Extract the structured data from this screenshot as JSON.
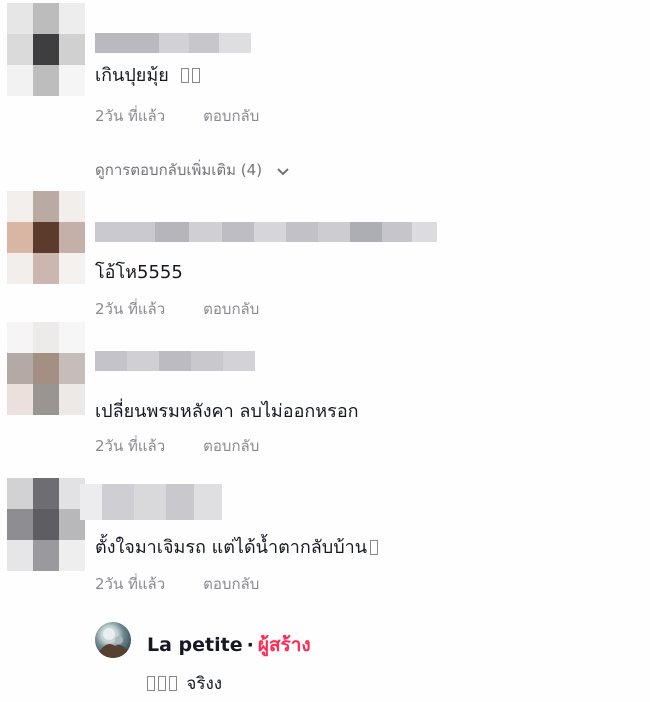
{
  "comments": [
    {
      "text": "เกินปุยมุ้ย",
      "emoji_placeholder_count": 2,
      "time": "2วัน ที่แล้ว",
      "reply_label": "ตอบกลับ"
    },
    {
      "text": "โอ้โห5555",
      "time": "2วัน ที่แล้ว",
      "reply_label": "ตอบกลับ"
    },
    {
      "text": "เปลี่ยนพรมหลังคา ลบไม่ออกหรอก",
      "time": "2วัน ที่แล้ว",
      "reply_label": "ตอบกลับ"
    },
    {
      "text": "ตั้งใจมาเจิมรถ แต่ได้น้ำตากลับบ้าน",
      "emoji_placeholder_count": 1,
      "time": "2วัน ที่แล้ว",
      "reply_label": "ตอบกลับ"
    }
  ],
  "view_more_replies": "ดูการตอบกลับเพิ่มเติม (4)",
  "creator_reply": {
    "name": "La petite",
    "separator": "·",
    "role": "ผู้สร้าง",
    "text": "จริงง",
    "emoji_placeholder_count": 3
  },
  "icons": {
    "chevron": "chevron-down-icon"
  },
  "colors": {
    "creator_badge": "#fe2c55",
    "meta_text": "#8a8b91",
    "primary_text": "#161823"
  }
}
